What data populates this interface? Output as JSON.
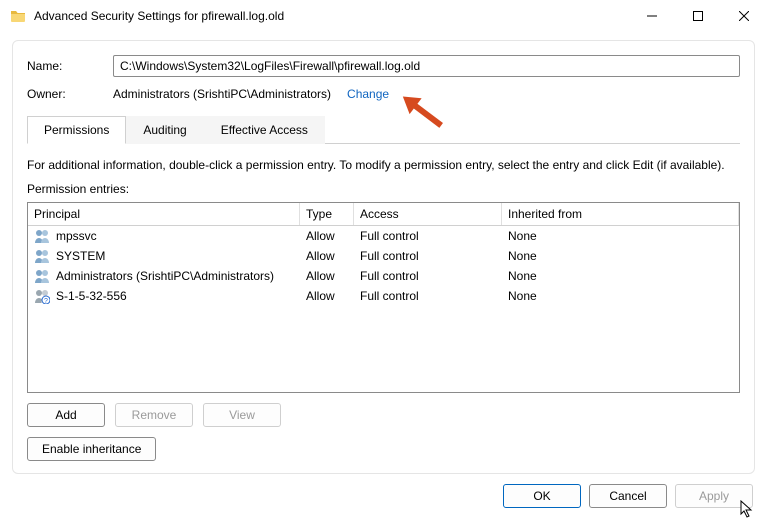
{
  "window": {
    "title": "Advanced Security Settings for pfirewall.log.old"
  },
  "fields": {
    "name_label": "Name:",
    "name_value": "C:\\Windows\\System32\\LogFiles\\Firewall\\pfirewall.log.old",
    "owner_label": "Owner:",
    "owner_value": "Administrators (SrishtiPC\\Administrators)",
    "change_link": "Change"
  },
  "tabs": {
    "permissions": "Permissions",
    "auditing": "Auditing",
    "effective": "Effective Access"
  },
  "info_text": "For additional information, double-click a permission entry. To modify a permission entry, select the entry and click Edit (if available).",
  "entries_label": "Permission entries:",
  "columns": {
    "principal": "Principal",
    "type": "Type",
    "access": "Access",
    "inherited": "Inherited from"
  },
  "rows": [
    {
      "icon": "group",
      "principal": "mpssvc",
      "type": "Allow",
      "access": "Full control",
      "inherited": "None"
    },
    {
      "icon": "group",
      "principal": "SYSTEM",
      "type": "Allow",
      "access": "Full control",
      "inherited": "None"
    },
    {
      "icon": "group",
      "principal": "Administrators (SrishtiPC\\Administrators)",
      "type": "Allow",
      "access": "Full control",
      "inherited": "None"
    },
    {
      "icon": "unknown",
      "principal": "S-1-5-32-556",
      "type": "Allow",
      "access": "Full control",
      "inherited": "None"
    }
  ],
  "buttons": {
    "add": "Add",
    "remove": "Remove",
    "view": "View",
    "enable_inherit": "Enable inheritance",
    "ok": "OK",
    "cancel": "Cancel",
    "apply": "Apply"
  },
  "icons": {
    "folder": "folder-icon",
    "minimize": "minimize-icon",
    "maximize": "maximize-icon",
    "close": "close-icon"
  },
  "colors": {
    "link": "#1065c0",
    "arrow": "#d64a1f"
  }
}
